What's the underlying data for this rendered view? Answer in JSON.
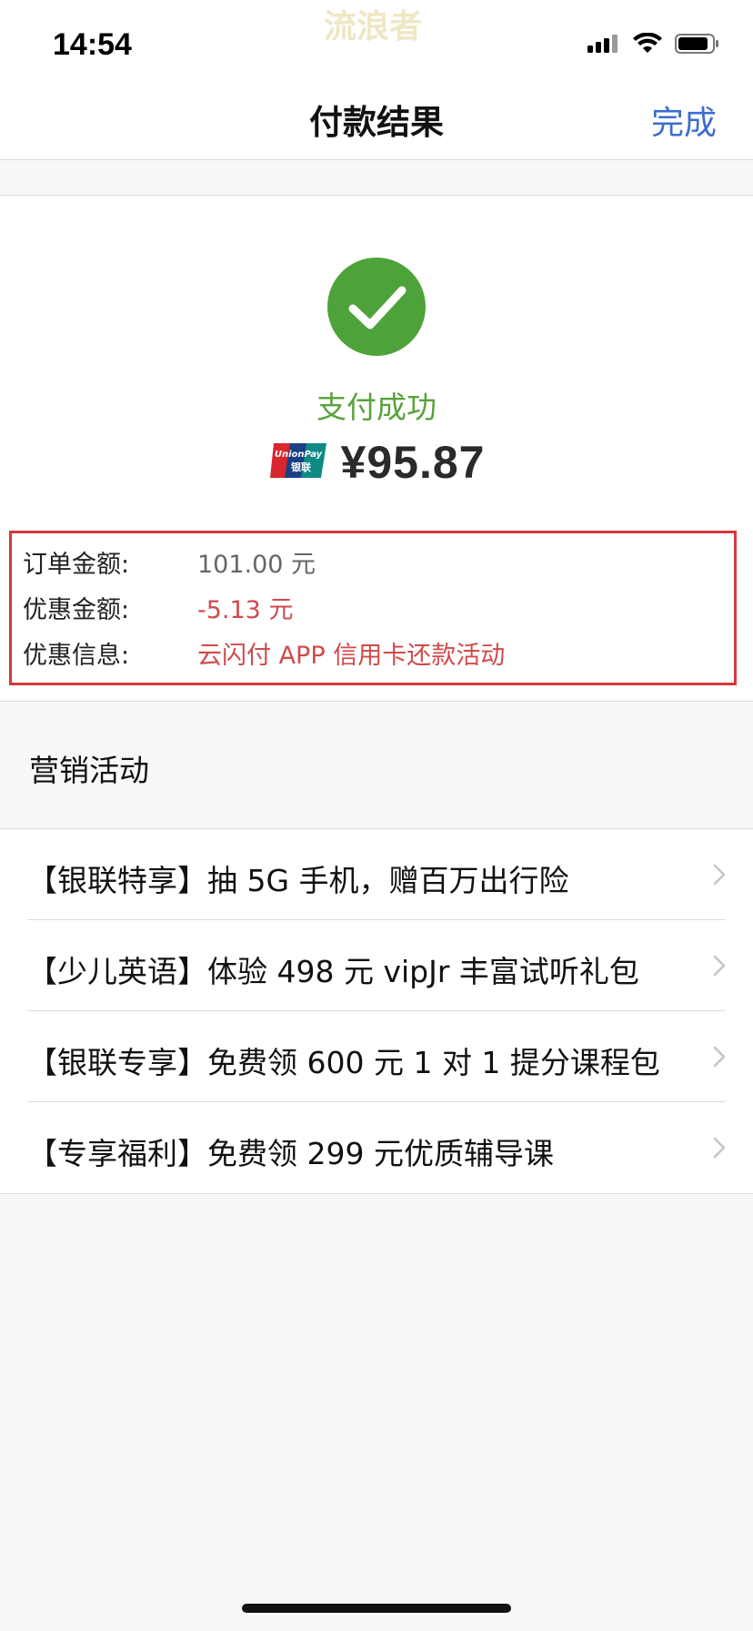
{
  "status_bar": {
    "time": "14:54",
    "watermark": "流浪者",
    "icons": [
      "signal-icon",
      "wifi-icon",
      "battery-icon"
    ]
  },
  "nav": {
    "title": "付款结果",
    "done_label": "完成"
  },
  "result": {
    "status_text": "支付成功",
    "status_icon": "check-icon",
    "amount": "¥95.87",
    "card_logo_text_top": "UnionPay",
    "card_logo_text_bottom": "银联",
    "success_color": "#4ea23a"
  },
  "details": [
    {
      "label": "订单金额:",
      "value": "101.00 元",
      "style": "gray"
    },
    {
      "label": "优惠金额:",
      "value": "-5.13 元",
      "style": "red"
    },
    {
      "label": "优惠信息:",
      "value": "云闪付 APP 信用卡还款活动",
      "style": "red"
    }
  ],
  "marketing": {
    "header": "营销活动",
    "items": [
      {
        "text": "【银联特享】抽 5G 手机，赠百万出行险"
      },
      {
        "text": "【少儿英语】体验 498 元 vipJr 丰富试听礼包"
      },
      {
        "text": "【银联专享】免费领 600 元 1 对 1 提分课程包"
      },
      {
        "text": "【专享福利】免费领 299 元优质辅导课"
      }
    ]
  },
  "colors": {
    "accent": "#3d6ccf",
    "highlight_border": "#d6393c",
    "discount_text": "#d04a4a"
  }
}
